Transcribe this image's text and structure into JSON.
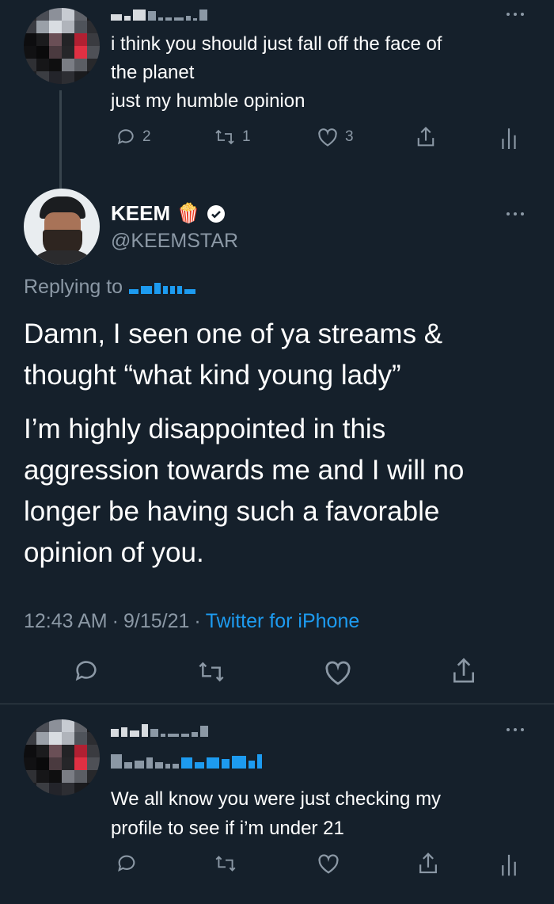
{
  "reply_top": {
    "text_lines": [
      "i think you should just fall off the face of",
      "the planet",
      "just my humble opinion"
    ],
    "actions": {
      "reply_count": "2",
      "retweet_count": "1",
      "like_count": "3"
    }
  },
  "main_tweet": {
    "display_name": "KEEM",
    "name_emoji": "🍿",
    "handle": "@KEEMSTAR",
    "replying_to_label": "Replying to",
    "paragraph_1": [
      "Damn, I seen one of ya streams &",
      "thought “what kind young lady”"
    ],
    "paragraph_2": [
      "I’m highly disappointed in this",
      "aggression towards me and I will no",
      "longer be having such a favorable",
      "opinion of you."
    ],
    "time": "12:43 AM",
    "date": "9/15/21",
    "source": "Twitter for iPhone"
  },
  "reply_bottom": {
    "text_lines": [
      "We all know you were just checking my",
      "profile to see if i’m under 21"
    ]
  },
  "colors": {
    "background": "#15202b",
    "secondary_text": "#8b98a5",
    "link": "#1d9bf0",
    "divider": "#38444d"
  },
  "icons": [
    "reply-icon",
    "retweet-icon",
    "like-icon",
    "share-icon",
    "analytics-icon",
    "verified-badge-icon",
    "more-icon"
  ]
}
